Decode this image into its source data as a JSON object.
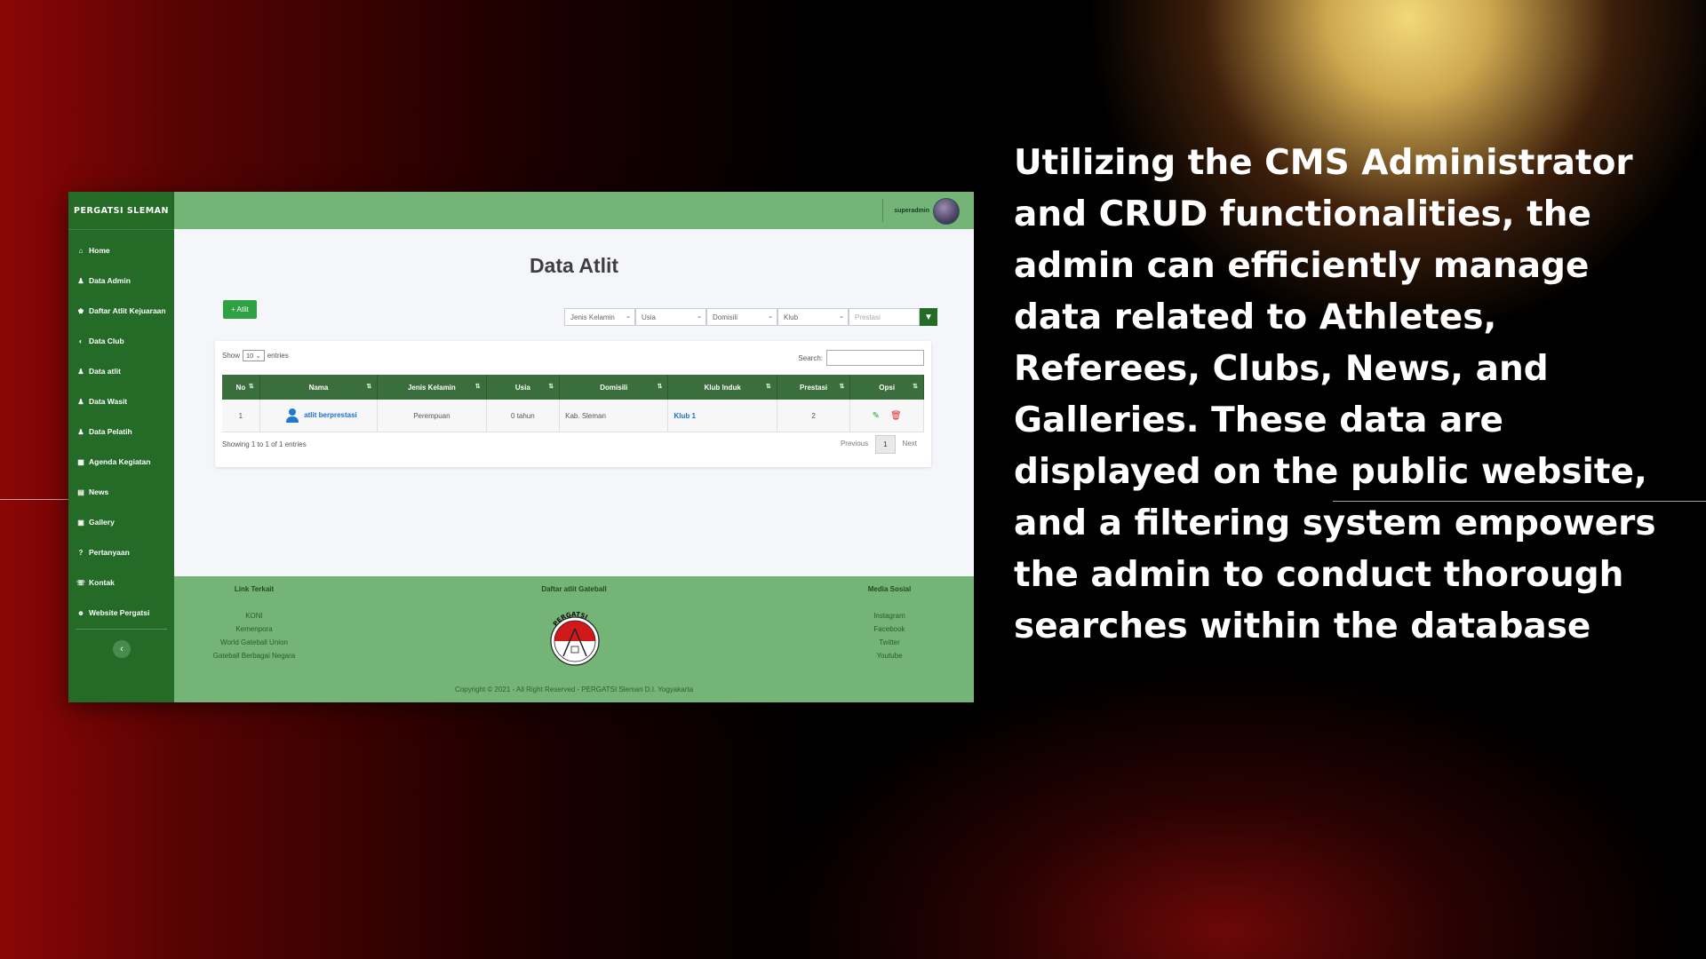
{
  "sidebar": {
    "brand": "PERGATSI SLEMAN",
    "items": [
      {
        "icon": "home-icon",
        "glyph": "⌂",
        "label": "Home"
      },
      {
        "icon": "user-icon",
        "glyph": "♟",
        "label": "Data Admin"
      },
      {
        "icon": "trophy-icon",
        "glyph": "♚",
        "label": "Daftar Atlit Kejuaraan"
      },
      {
        "icon": "shield-icon",
        "glyph": "◐",
        "label": "Data Club"
      },
      {
        "icon": "user-icon",
        "glyph": "♟",
        "label": "Data atlit"
      },
      {
        "icon": "user-plus-icon",
        "glyph": "♟",
        "label": "Data Wasit"
      },
      {
        "icon": "user-icon",
        "glyph": "♟",
        "label": "Data Pelatih"
      },
      {
        "icon": "calendar-icon",
        "glyph": "▦",
        "label": "Agenda Kegiatan"
      },
      {
        "icon": "newspaper-icon",
        "glyph": "▤",
        "label": "News"
      },
      {
        "icon": "image-icon",
        "glyph": "▣",
        "label": "Gallery"
      },
      {
        "icon": "question-icon",
        "glyph": "?",
        "label": "Pertanyaan"
      },
      {
        "icon": "phone-icon",
        "glyph": "☏",
        "label": "Kontak"
      },
      {
        "icon": "users-icon",
        "glyph": "☻",
        "label": "Website Pergatsi"
      }
    ],
    "collapse_glyph": "‹"
  },
  "topbar": {
    "username": "superadmin"
  },
  "main": {
    "title": "Data Atlit",
    "add_button": "+ Atlit",
    "filters": [
      "Jenis Kelamin",
      "Usia",
      "Domisili",
      "Klub"
    ],
    "filter_prestasi_placeholder": "Prestasi",
    "filter_button_glyph": "▼",
    "show_label": "Show",
    "entries_value": "10",
    "entries_label": "entries",
    "search_label": "Search:",
    "columns": [
      "No",
      "Nama",
      "Jenis Kelamin",
      "Usia",
      "Domisili",
      "Klub Induk",
      "Prestasi",
      "Opsi"
    ],
    "rows": [
      {
        "no": "1",
        "nama": "atlit berprestasi",
        "jenis_kelamin": "Perempuan",
        "usia": "0 tahun",
        "domisili": "Kab. Sleman",
        "klub": "Klub 1",
        "prestasi": "2"
      }
    ],
    "info": "Showing 1 to 1 of 1 entries",
    "pager": {
      "previous": "Previous",
      "current": "1",
      "next": "Next"
    }
  },
  "footer": {
    "col1_title": "Link Terkait",
    "col1_links": [
      "KONI",
      "Kemenpora",
      "World Gateball Union",
      "Gateball Berbagai Negara"
    ],
    "col2_title": "Daftar atlit Gateball",
    "col3_title": "Media Sosial",
    "col3_links": [
      "Instagram",
      "Facebook",
      "Twitter",
      "Youtube"
    ],
    "copyright": "Copyright © 2021 - All Right Reserved - PERGATSI Sleman D.I. Yogyakarta",
    "logo_text": "PERGATSI"
  },
  "description": "Utilizing the CMS Administrator and CRUD functionalities, the admin can efficiently manage data related to Athletes, Referees, Clubs, News, and Galleries. These data are displayed on the public website, and a filtering system empowers the admin to conduct thorough searches within the database",
  "colors": {
    "sidebar": "#236b27",
    "topbar": "#74b577",
    "accent": "#2ea143",
    "link": "#1d6fd0"
  }
}
